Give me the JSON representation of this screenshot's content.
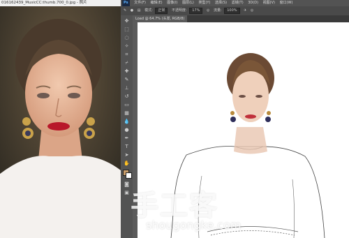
{
  "photo_viewer": {
    "title": "016162439_MusicCC:thumb.700_0.jpg - 照片"
  },
  "photoshop": {
    "logo": "Ps",
    "menu": [
      "文件(F)",
      "编辑(E)",
      "图像(I)",
      "图层(L)",
      "类型(Y)",
      "选择(S)",
      "滤镜(T)",
      "3D(D)",
      "视图(V)",
      "窗口(W)"
    ],
    "options": {
      "mode_label": "模式:",
      "mode_value": "正常",
      "opacity_label": "不透明度:",
      "opacity_value": "17%",
      "flow_label": "流量:",
      "flow_value": "100%"
    },
    "document_tab": "Load @ 64.7% (头发, RGB/8)",
    "colors": {
      "foreground": "#c99d6a",
      "background": "#ffffff"
    }
  },
  "watermark": {
    "chinese": "手工客",
    "url": "shougongke.com"
  }
}
